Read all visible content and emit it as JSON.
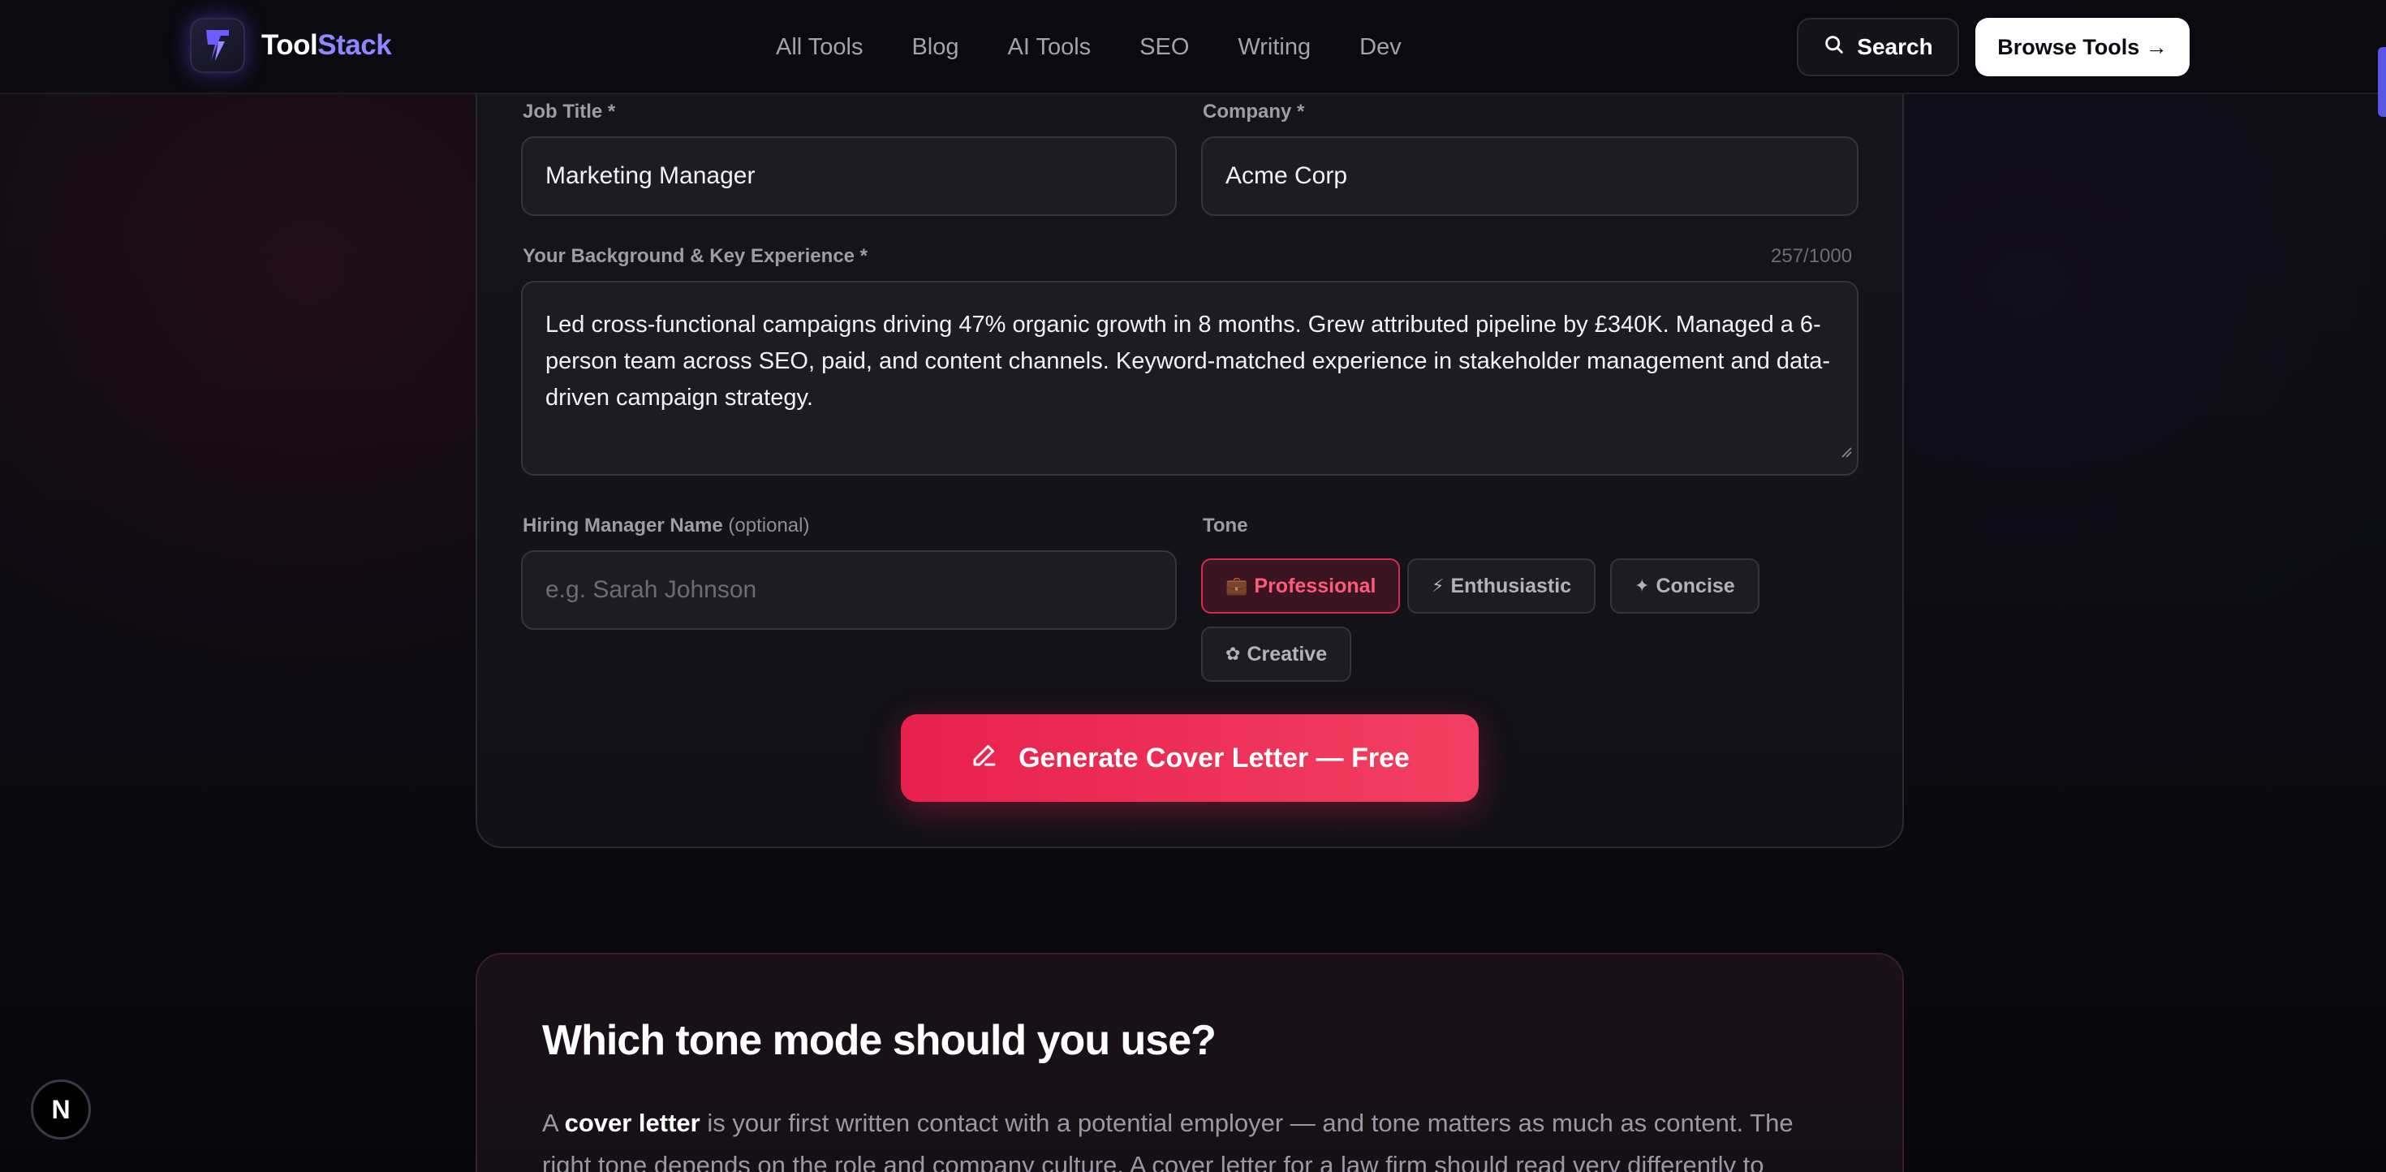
{
  "brand": {
    "name_part1": "Tool",
    "name_part2": "Stack"
  },
  "nav": {
    "links": [
      "All Tools",
      "Blog",
      "AI Tools",
      "SEO",
      "Writing",
      "Dev"
    ],
    "search_label": "Search",
    "browse_label": "Browse Tools →"
  },
  "form": {
    "job_title": {
      "label": "Job Title *",
      "value": "Marketing Manager"
    },
    "company": {
      "label": "Company *",
      "value": "Acme Corp"
    },
    "background": {
      "label": "Your Background & Key Experience *",
      "counter": "257/1000",
      "value": "Led cross-functional campaigns driving 47% organic growth in 8 months. Grew attributed pipeline by £340K. Managed a 6-person team across SEO, paid, and content channels. Keyword-matched experience in stakeholder management and data-driven campaign strategy."
    },
    "hiring_manager": {
      "label": "Hiring Manager Name",
      "label_optional": "(optional)",
      "placeholder": "e.g. Sarah Johnson"
    },
    "tone": {
      "label": "Tone",
      "options": [
        {
          "icon": "💼",
          "label": "Professional",
          "selected": true
        },
        {
          "icon": "⚡",
          "label": "Enthusiastic",
          "selected": false
        },
        {
          "icon": "✦",
          "label": "Concise",
          "selected": false
        },
        {
          "icon": "✿",
          "label": "Creative",
          "selected": false
        }
      ]
    },
    "generate_label": "Generate Cover Letter — Free"
  },
  "info": {
    "title": "Which tone mode should you use?",
    "body_prefix": "A ",
    "body_bold": "cover letter",
    "body_rest": " is your first written contact with a potential employer — and tone matters as much as content. The right tone depends on the role and company culture. A cover letter for a law firm should read very differently to"
  },
  "badge_letter": "N",
  "colors": {
    "accent": "#e8204d",
    "brand_purple": "#8f87ff",
    "background": "#08080d"
  }
}
